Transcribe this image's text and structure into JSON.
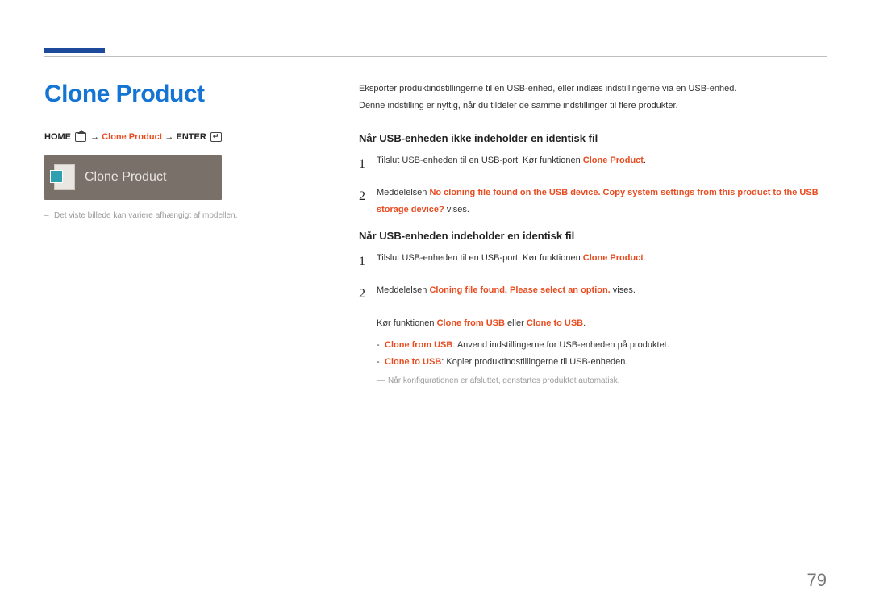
{
  "title": "Clone Product",
  "breadcrumb": {
    "home": "HOME",
    "arrow1": " → ",
    "clone": "Clone Product",
    "arrow2": " → ",
    "enter": "ENTER"
  },
  "preview_label": "Clone Product",
  "image_note": "Det viste billede kan variere afhængigt af modellen.",
  "intro_line1": "Eksporter produktindstillingerne til en USB-enhed, eller indlæs indstillingerne via en USB-enhed.",
  "intro_line2": "Denne indstilling er nyttig, når du tildeler de samme indstillinger til flere produkter.",
  "section1": {
    "heading": "Når USB-enheden ikke indeholder en identisk fil",
    "steps": [
      {
        "num": "1",
        "pre": "Tilslut USB-enheden til en USB-port. Kør funktionen ",
        "hl": "Clone Product",
        "post": "."
      },
      {
        "num": "2",
        "pre": "Meddelelsen ",
        "hl": "No cloning file found on the USB device. Copy system settings from this product to the USB storage device?",
        "post": " vises."
      }
    ]
  },
  "section2": {
    "heading": "Når USB-enheden indeholder en identisk fil",
    "steps": [
      {
        "num": "1",
        "pre": "Tilslut USB-enheden til en USB-port. Kør funktionen ",
        "hl": "Clone Product",
        "post": "."
      },
      {
        "num": "2",
        "pre": "Meddelelsen ",
        "hl": "Cloning file found. Please select an option.",
        "post": " vises."
      }
    ],
    "run_pre": "Kør funktionen ",
    "run_a": "Clone from USB",
    "run_mid": " eller ",
    "run_b": "Clone to USB",
    "run_post": ".",
    "items": [
      {
        "hl": "Clone from USB",
        "text": ": Anvend indstillingerne for USB-enheden på produktet."
      },
      {
        "hl": "Clone to USB",
        "text": ": Kopier produktindstillingerne til USB-enheden."
      }
    ],
    "footnote": "Når konfigurationen er afsluttet, genstartes produktet automatisk."
  },
  "page_number": "79"
}
